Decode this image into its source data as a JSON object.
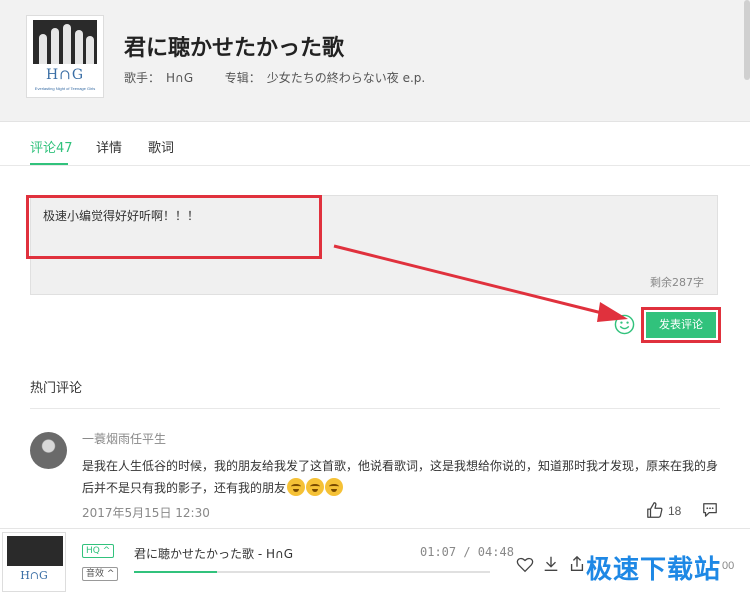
{
  "song": {
    "title": "君に聴かせたかった歌",
    "singer_label": "歌手：",
    "singer": "H∩G",
    "album_label": "专辑：",
    "album": "少女たちの終わらない夜 e.p.",
    "cover_band": "H∩G",
    "cover_sub": "Everlasting Night of Teenage Girls"
  },
  "tabs": [
    {
      "label": "评论47",
      "active": true
    },
    {
      "label": "详情",
      "active": false
    },
    {
      "label": "歌词",
      "active": false
    }
  ],
  "comment_input": {
    "value": "极速小编觉得好好听啊！！！",
    "remaining": "剩余287字"
  },
  "submit_label": "发表评论",
  "hot_comments": {
    "title": "热门评论",
    "items": [
      {
        "user": "一蓑烟雨任平生",
        "text": "是我在人生低谷的时候，我的朋友给我发了这首歌，他说看歌词，这是我想给你说的，知道那时我才发现，原来在我的身后并不是只有我的影子，还有我的朋友",
        "date": "2017年5月15日  12:30",
        "likes": "18"
      }
    ]
  },
  "player": {
    "quality_badge": "HQ ^",
    "effect_badge": "音效 ^",
    "title": "君に聴かせたかった歌 - H∩G",
    "time": "01:07 / 04:48",
    "progress": 0.232,
    "end_time_partial": "00"
  },
  "watermark": "极速下载站",
  "colors": {
    "accent": "#31c27c",
    "highlight": "#e0313d",
    "watermark": "#1e88e5"
  }
}
